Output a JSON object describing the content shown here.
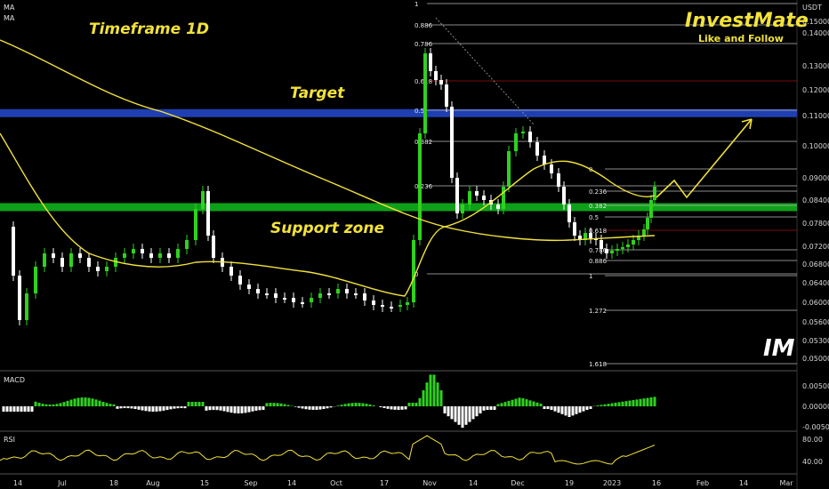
{
  "chart_data": {
    "type": "candlestick",
    "timeframe_label": "Timeframe 1D",
    "price_axis_unit": "USDT",
    "y_ticks": [
      "0.15000",
      "0.14000",
      "0.13000",
      "0.12000",
      "0.11000",
      "0.10000",
      "0.09000",
      "0.08400",
      "0.07800",
      "0.07200",
      "0.06800",
      "0.06400",
      "0.06000",
      "0.05600",
      "0.05300",
      "0.05000"
    ],
    "x_ticks": [
      "14",
      "Jul",
      "18",
      "Aug",
      "15",
      "Sep",
      "14",
      "Oct",
      "17",
      "Nov",
      "14",
      "Dec",
      "19",
      "2023",
      "16",
      "Feb",
      "14",
      "Mar"
    ],
    "indicator_labels": [
      "MA",
      "MA"
    ],
    "annotations": [
      "Target",
      "Support zone"
    ],
    "target_zone": [
      0.11,
      0.1125
    ],
    "support_zone": [
      0.0815,
      0.0832
    ],
    "fib_retracement_1": {
      "levels": [
        "1",
        "0.886",
        "0.786",
        "0.618",
        "0.5",
        "0.382",
        "0.236",
        "0"
      ],
      "values": [
        1,
        0.886,
        0.786,
        0.618,
        0.5,
        0.382,
        0.236,
        0
      ]
    },
    "fib_retracement_2": {
      "levels": [
        "0",
        "0.236",
        "0.382",
        "0.5",
        "0.618",
        "0.786",
        "0.886",
        "1",
        "1.272",
        "1.618"
      ],
      "values": [
        0,
        0.236,
        0.382,
        0.5,
        0.618,
        0.786,
        0.886,
        1,
        1.272,
        1.618
      ]
    },
    "macd": {
      "label": "MACD",
      "y_ticks": [
        "0.00500",
        "0.00000",
        "-0.00500"
      ]
    },
    "rsi": {
      "label": "RSI",
      "y_ticks": [
        "80.00",
        "40.00"
      ]
    },
    "colors": {
      "up": "#2fd11f",
      "down": "#ffffff",
      "ma_slow": "#f2e23a",
      "ma_fast": "#f2e23a",
      "target": "#1f3fb0",
      "support": "#0fa01a"
    }
  },
  "brand": {
    "title": "InvestMate",
    "subtitle": "Like and Follow",
    "logo_text": "IM"
  }
}
